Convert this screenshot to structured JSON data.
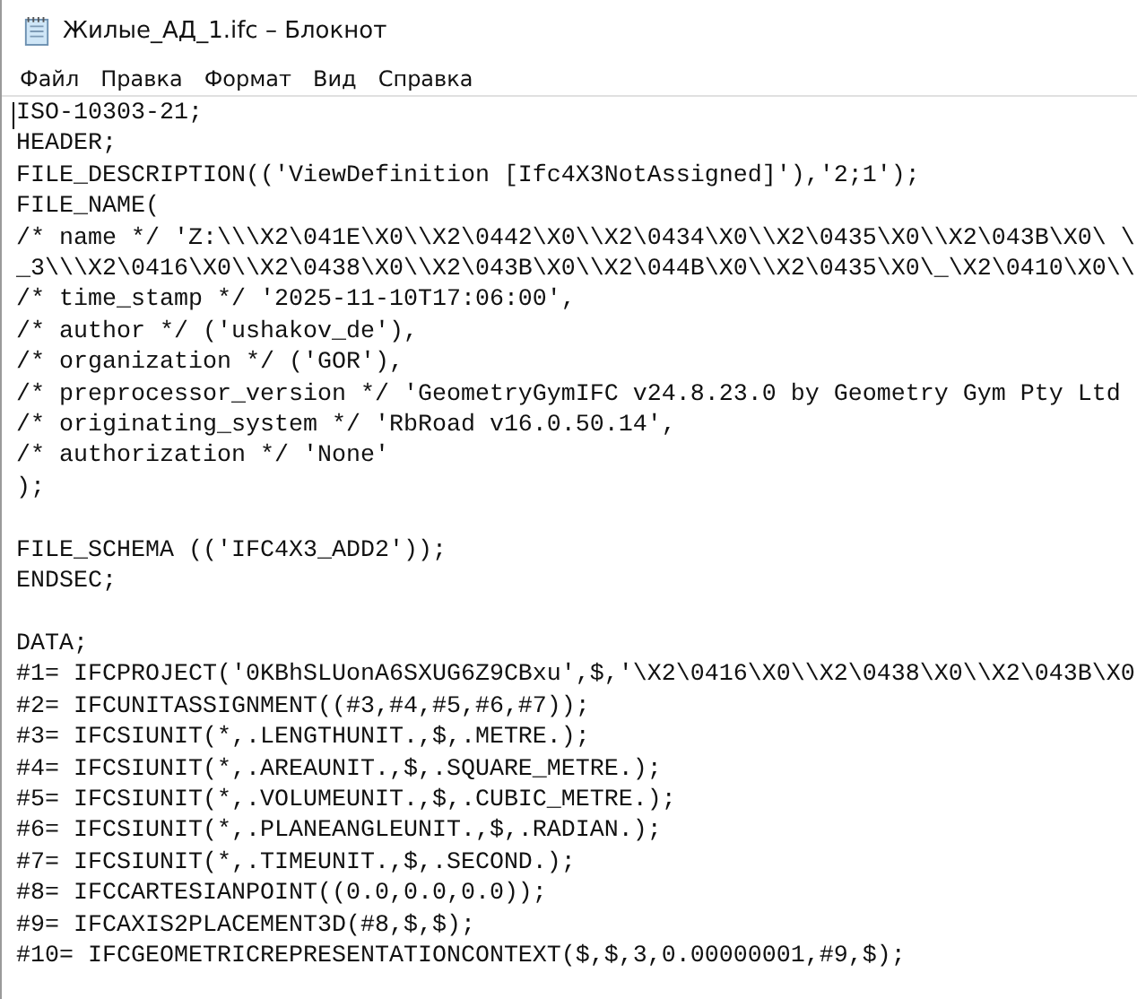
{
  "window": {
    "title": "Жилые_АД_1.ifc – Блокнот"
  },
  "menu": [
    "Файл",
    "Правка",
    "Формат",
    "Вид",
    "Справка"
  ],
  "editor": {
    "blocks": [
      [
        "ISO-10303-21;",
        "HEADER;",
        "FILE_DESCRIPTION(('ViewDefinition [Ifc4X3NotAssigned]'),'2;1');",
        "FILE_NAME(",
        "/* name */ 'Z:\\\\\\X2\\041E\\X0\\\\X2\\0442\\X0\\\\X2\\0434\\X0\\\\X2\\0435\\X0\\\\X2\\043B\\X0\\ \\",
        "_3\\\\\\X2\\0416\\X0\\\\X2\\0438\\X0\\\\X2\\043B\\X0\\\\X2\\044B\\X0\\\\X2\\0435\\X0\\_\\X2\\0410\\X0\\\\",
        "/* time_stamp */ '2025-11-10T17:06:00',",
        "/* author */ ('ushakov_de'),",
        "/* organization */ ('GOR'),",
        "/* preprocessor_version */ 'GeometryGymIFC v24.8.23.0 by Geometry Gym Pty Ltd",
        "/* originating_system */ 'RbRoad v16.0.50.14',",
        "/* authorization */ 'None'",
        ");"
      ],
      [
        "FILE_SCHEMA (('IFC4X3_ADD2'));",
        "ENDSEC;"
      ],
      [
        "DATA;",
        "#1= IFCPROJECT('0KBhSLUonA6SXUG6Z9CBxu',$,'\\X2\\0416\\X0\\\\X2\\0438\\X0\\\\X2\\043B\\X0",
        "#2= IFCUNITASSIGNMENT((#3,#4,#5,#6,#7));",
        "#3= IFCSIUNIT(*,.LENGTHUNIT.,$,.METRE.);",
        "#4= IFCSIUNIT(*,.AREAUNIT.,$,.SQUARE_METRE.);",
        "#5= IFCSIUNIT(*,.VOLUMEUNIT.,$,.CUBIC_METRE.);",
        "#6= IFCSIUNIT(*,.PLANEANGLEUNIT.,$,.RADIAN.);",
        "#7= IFCSIUNIT(*,.TIMEUNIT.,$,.SECOND.);",
        "#8= IFCCARTESIANPOINT((0.0,0.0,0.0));",
        "#9= IFCAXIS2PLACEMENT3D(#8,$,$);",
        "#10= IFCGEOMETRICREPRESENTATIONCONTEXT($,$,3,0.00000001,#9,$);"
      ]
    ]
  }
}
